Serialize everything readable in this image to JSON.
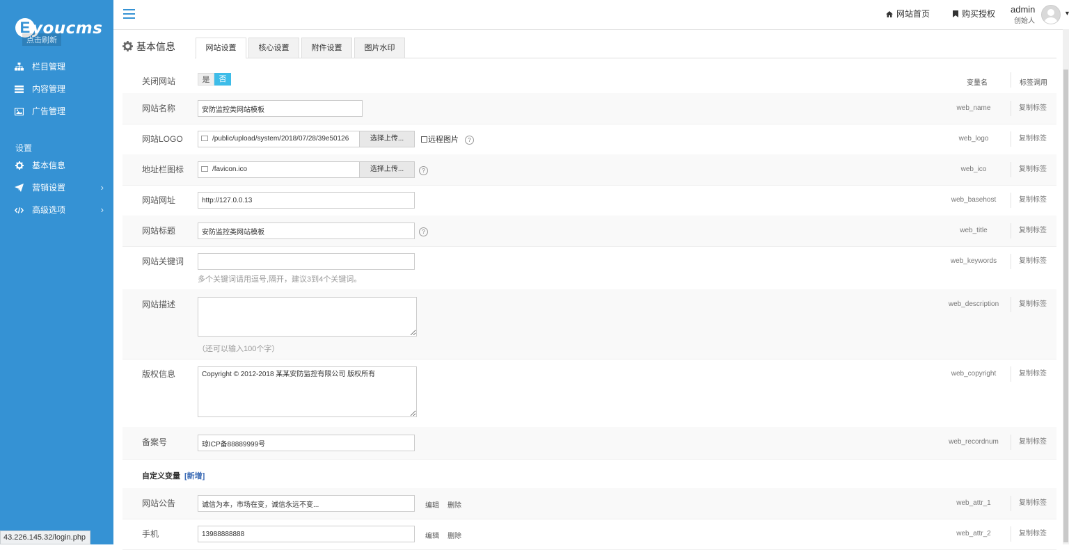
{
  "sidebar": {
    "logo_letter": "E",
    "logo_text": "youcms",
    "logo_refresh": "点击刷新",
    "items": [
      {
        "label": "栏目管理",
        "icon": "sitemap-icon"
      },
      {
        "label": "内容管理",
        "icon": "list-icon"
      },
      {
        "label": "广告管理",
        "icon": "image-icon"
      }
    ],
    "section_label": "设置",
    "settings_items": [
      {
        "label": "基本信息",
        "icon": "gear-icon"
      },
      {
        "label": "营销设置",
        "icon": "paper-plane-icon",
        "chevron": "›"
      },
      {
        "label": "高级选项",
        "icon": "code-icon",
        "chevron": "›"
      }
    ]
  },
  "topbar": {
    "home_link": "网站首页",
    "buy_link": "购买授权",
    "user_name": "admin",
    "user_role": "创始人"
  },
  "page": {
    "title": "基本信息",
    "tabs": [
      "网站设置",
      "核心设置",
      "附件设置",
      "图片水印"
    ],
    "active_tab": 0
  },
  "columns": {
    "var_name": "变量名",
    "tag_call": "标签调用"
  },
  "form": {
    "close_site": {
      "label": "关闭网站",
      "yes": "是",
      "no": "否",
      "selected": "否"
    },
    "web_name": {
      "label": "网站名称",
      "value": "安防监控类网站模板",
      "var": "web_name"
    },
    "web_logo": {
      "label": "网站LOGO",
      "value": "/public/upload/system/2018/07/28/39e50126",
      "button": "选择上传...",
      "remote": "远程图片",
      "var": "web_logo"
    },
    "web_ico": {
      "label": "地址栏图标",
      "value": "/favicon.ico",
      "button": "选择上传...",
      "var": "web_ico"
    },
    "web_basehost": {
      "label": "网站网址",
      "value": "http://127.0.0.13",
      "var": "web_basehost"
    },
    "web_title": {
      "label": "网站标题",
      "value": "安防监控类网站模板",
      "var": "web_title"
    },
    "web_keywords": {
      "label": "网站关键词",
      "value": "",
      "hint": "多个关键词请用逗号,隔开，建议3到4个关键词。",
      "var": "web_keywords"
    },
    "web_description": {
      "label": "网站描述",
      "value": "",
      "hint": "（还可以输入100个字）",
      "var": "web_description"
    },
    "web_copyright": {
      "label": "版权信息",
      "value": "Copyright © 2012-2018 某某安防监控有限公司 版权所有",
      "var": "web_copyright"
    },
    "web_recordnum": {
      "label": "备案号",
      "value": "琼ICP备88889999号",
      "var": "web_recordnum"
    }
  },
  "custom": {
    "title": "自定义变量",
    "new_link": "[新增]",
    "edit": "编辑",
    "delete": "删除",
    "rows": [
      {
        "label": "网站公告",
        "value": "诚信为本，市场在变，诚信永远不变...",
        "var": "web_attr_1"
      },
      {
        "label": "手机",
        "value": "13988888888",
        "var": "web_attr_2"
      }
    ]
  },
  "copy_tag": "复制标签",
  "help_glyph": "?",
  "status_url": "43.226.145.32/login.php",
  "colors": {
    "sidebar": "#3592d4",
    "accent": "#3dbce8",
    "link": "#3b6bb5"
  }
}
